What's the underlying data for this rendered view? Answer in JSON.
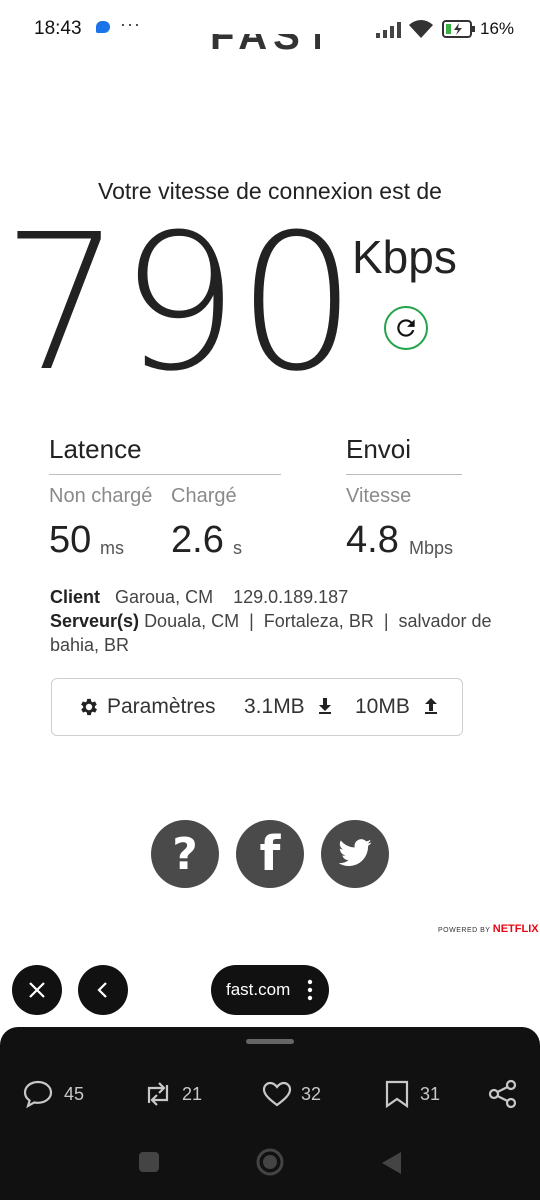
{
  "status_bar": {
    "time": "18:43",
    "dots": "···",
    "battery": "16%"
  },
  "logo": "FAST",
  "speed": {
    "caption": "Votre vitesse de connexion est de",
    "value": "790",
    "unit": "Kbps"
  },
  "latency": {
    "heading": "Latence",
    "unloaded_label": "Non chargé",
    "loaded_label": "Chargé",
    "unloaded_value": "50",
    "unloaded_unit": "ms",
    "loaded_value": "2.6",
    "loaded_unit": "s"
  },
  "upload": {
    "heading": "Envoi",
    "label": "Vitesse",
    "value": "4.8",
    "unit": "Mbps"
  },
  "client": {
    "label": "Client",
    "location": "Garoua, CM",
    "ip": "129.0.189.187"
  },
  "servers": {
    "label": "Serveur(s)",
    "list": "Douala, CM  |  Fortaleza, BR  |  salvador de bahia, BR"
  },
  "settings": {
    "label": "Paramètres",
    "download": "3.1MB",
    "upload": "10MB"
  },
  "social": [
    "help-icon",
    "facebook-icon",
    "twitter-icon"
  ],
  "powered_by": {
    "text": "POWERED BY",
    "brand": "NETFLIX"
  },
  "browser": {
    "url": "fast.com"
  },
  "tweet_actions": {
    "replies": "45",
    "retweets": "21",
    "likes": "32",
    "bookmarks": "31"
  },
  "colors": {
    "refresh_green": "#22a34a",
    "netflix_red": "#e50914",
    "bar_dark": "#111111"
  }
}
